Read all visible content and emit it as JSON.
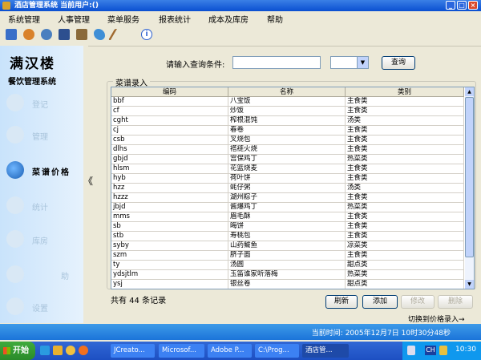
{
  "window": {
    "title": "酒店管理系统  当前用户:()",
    "controls": [
      "_",
      "□",
      "×"
    ]
  },
  "menu": {
    "items": [
      "系统管理",
      "人事管理",
      "菜单服务",
      "报表统计",
      "成本及库房",
      "帮助"
    ]
  },
  "toolbar": {
    "icons": [
      "computer-icon",
      "people-icon",
      "gear-icon",
      "book-icon",
      "cart-icon",
      "fish-icon",
      "pen-icon",
      "info-icon"
    ]
  },
  "sidebar": {
    "brand_line1": "满汉楼",
    "brand_line2": "餐饮管理系统",
    "items": [
      {
        "label": "登记",
        "icon": "register-icon",
        "active": false
      },
      {
        "label": "管理",
        "icon": "manage-icon",
        "active": false
      },
      {
        "label": "菜谱价格",
        "icon": "menu-price-icon",
        "active": true
      },
      {
        "label": "统计",
        "icon": "stats-icon",
        "active": false
      },
      {
        "label": "库房",
        "icon": "warehouse-icon",
        "active": false
      },
      {
        "label": "助",
        "icon": "help-icon",
        "active": false
      },
      {
        "label": "设置",
        "icon": "settings-icon",
        "active": false
      }
    ],
    "collapse_arrow": "《"
  },
  "search": {
    "label": "请输入查询条件:",
    "value": "",
    "category_value": "",
    "button_label": "查询"
  },
  "panel": {
    "title": "菜谱录入",
    "columns": [
      "编码",
      "名称",
      "类别"
    ],
    "rows": [
      [
        "bbf",
        "八宝饭",
        "主食类"
      ],
      [
        "cf",
        "炒饭",
        "主食类"
      ],
      [
        "cght",
        "榨根混饨",
        "汤类"
      ],
      [
        "cj",
        "春卷",
        "主食类"
      ],
      [
        "csb",
        "叉烧包",
        "主食类"
      ],
      [
        "dlhs",
        "褡裢火烧",
        "主食类"
      ],
      [
        "gbjd",
        "宫保鸡丁",
        "热菜类"
      ],
      [
        "hlsm",
        "花篮烧麦",
        "主食类"
      ],
      [
        "hyb",
        "荷叶饼",
        "主食类"
      ],
      [
        "hzz",
        "蚝仔粥",
        "汤类"
      ],
      [
        "hzzz",
        "湖州粽子",
        "主食类"
      ],
      [
        "jbjd",
        "酱爆鸡丁",
        "热菜类"
      ],
      [
        "mms",
        "眉毛酥",
        "主食类"
      ],
      [
        "sb",
        "晦饼",
        "主食类"
      ],
      [
        "stb",
        "寿桃包",
        "主食类"
      ],
      [
        "syby",
        "山药鲅鱼",
        "凉菜类"
      ],
      [
        "szm",
        "脐子面",
        "主食类"
      ],
      [
        "ty",
        "汤圆",
        "甜点类"
      ],
      [
        "ydsjtlm",
        "玉笛谁家听落梅",
        "热菜类"
      ],
      [
        "ysj",
        "银丝卷",
        "甜点类"
      ]
    ],
    "record_count_text": "共有 44 条记录",
    "buttons": {
      "refresh": "刷新",
      "add": "添加",
      "edit": "修改",
      "delete": "删除"
    },
    "switch_link": "切换到价格录入→"
  },
  "status": {
    "text": "当前时间:  2005年12月7日  10时30分48秒"
  },
  "taskbar": {
    "start_label": "开始",
    "tasks": [
      {
        "label": "JCreato...",
        "active": false
      },
      {
        "label": "Microsof...",
        "active": false
      },
      {
        "label": "Adobe P...",
        "active": false
      },
      {
        "label": "C:\\Prog...",
        "active": false
      },
      {
        "label": "酒店管...",
        "active": true
      }
    ],
    "ime": "CH",
    "clock": "10:30"
  }
}
